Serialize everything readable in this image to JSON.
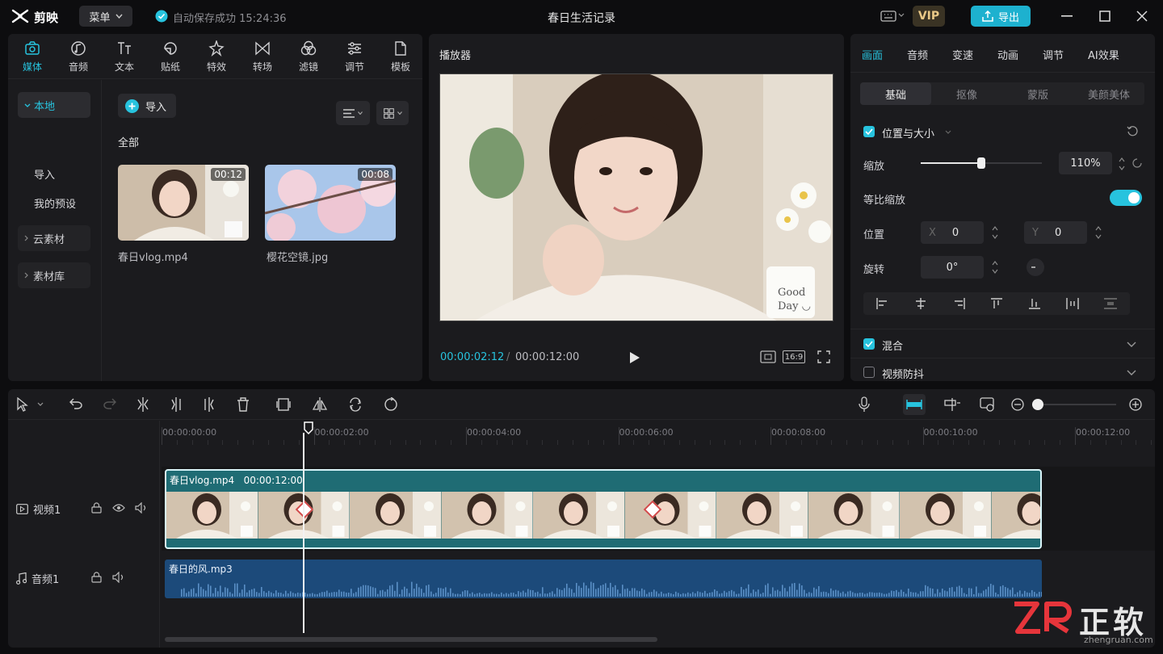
{
  "app": {
    "logo": "剪映",
    "menu": "菜单",
    "autosave": "自动保存成功 15:24:36",
    "title": "春日生活记录",
    "vip": "VIP",
    "export": "导出"
  },
  "media_tabs": [
    {
      "label": "媒体",
      "icon": "media-icon"
    },
    {
      "label": "音频",
      "icon": "audio-icon"
    },
    {
      "label": "文本",
      "icon": "text-icon"
    },
    {
      "label": "贴纸",
      "icon": "sticker-icon"
    },
    {
      "label": "特效",
      "icon": "effects-icon"
    },
    {
      "label": "转场",
      "icon": "transition-icon"
    },
    {
      "label": "滤镜",
      "icon": "filter-icon"
    },
    {
      "label": "调节",
      "icon": "adjust-icon"
    },
    {
      "label": "模板",
      "icon": "template-icon"
    }
  ],
  "sidebar": {
    "local": "本地",
    "import": "导入",
    "presets": "我的预设",
    "cloud": "云素材",
    "library": "素材库"
  },
  "media": {
    "import_btn": "导入",
    "all": "全部",
    "items": [
      {
        "name": "春日vlog.mp4",
        "duration": "00:12"
      },
      {
        "name": "樱花空镜.jpg",
        "duration": "00:08"
      }
    ]
  },
  "player": {
    "title": "播放器",
    "current": "00:00:02:12",
    "separator": "/",
    "total": "00:00:12:00",
    "ratio": "16:9",
    "mug_text_1": "Good",
    "mug_text_2": "Day ◡"
  },
  "props": {
    "tabs": [
      "画面",
      "音频",
      "变速",
      "动画",
      "调节",
      "AI效果"
    ],
    "subtabs": [
      "基础",
      "抠像",
      "蒙版",
      "美颜美体"
    ],
    "pos_size": "位置与大小",
    "scale_label": "缩放",
    "scale_value": "110%",
    "scale_level": 0.5,
    "uniform_label": "等比缩放",
    "position_label": "位置",
    "x_label": "X",
    "x_value": "0",
    "y_label": "Y",
    "y_value": "0",
    "rotate_label": "旋转",
    "rotate_value": "0°",
    "blend": "混合",
    "stabilize": "视频防抖"
  },
  "timeline": {
    "ruler": [
      "00:00:00:00",
      "00:00:02:00",
      "00:00:04:00",
      "00:00:06:00",
      "00:00:08:00",
      "00:00:10:00",
      "00:00:12:00"
    ],
    "video_track": "视频1",
    "audio_track": "音频1",
    "video_clip": "春日vlog.mp4   00:00:12:00",
    "audio_clip": "春日的风.mp3"
  },
  "watermark": {
    "brand": "正软",
    "url": "zhengruan.com"
  },
  "colors": {
    "accent": "#27c3de",
    "panel": "#1b1b1e",
    "video_clip": "#1f6c74",
    "audio_clip": "#1c4a7a"
  }
}
